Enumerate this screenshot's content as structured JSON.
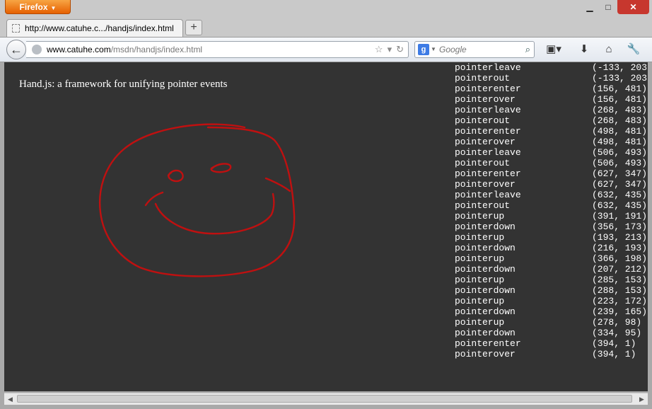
{
  "browser": {
    "menu_label": "Firefox",
    "tab_title": "http://www.catuhe.c.../handjs/index.html",
    "url_host": "www.catuhe.com",
    "url_path": "/msdn/handjs/index.html",
    "search_placeholder": "Google",
    "search_engine_letter": "g"
  },
  "page": {
    "heading": "Hand.js: a framework for unifying pointer events",
    "stroke_color": "#c01010",
    "background_color": "#333333"
  },
  "log": [
    {
      "event": "pointerleave",
      "coords": "(-133, 203"
    },
    {
      "event": "pointerout",
      "coords": "(-133, 203"
    },
    {
      "event": "pointerenter",
      "coords": "(156, 481)"
    },
    {
      "event": "pointerover",
      "coords": "(156, 481)"
    },
    {
      "event": "pointerleave",
      "coords": "(268, 483)"
    },
    {
      "event": "pointerout",
      "coords": "(268, 483)"
    },
    {
      "event": "pointerenter",
      "coords": "(498, 481)"
    },
    {
      "event": "pointerover",
      "coords": "(498, 481)"
    },
    {
      "event": "pointerleave",
      "coords": "(506, 493)"
    },
    {
      "event": "pointerout",
      "coords": "(506, 493)"
    },
    {
      "event": "pointerenter",
      "coords": "(627, 347)"
    },
    {
      "event": "pointerover",
      "coords": "(627, 347)"
    },
    {
      "event": "pointerleave",
      "coords": "(632, 435)"
    },
    {
      "event": "pointerout",
      "coords": "(632, 435)"
    },
    {
      "event": "pointerup",
      "coords": "(391, 191)"
    },
    {
      "event": "pointerdown",
      "coords": "(356, 173)"
    },
    {
      "event": "pointerup",
      "coords": "(193, 213)"
    },
    {
      "event": "pointerdown",
      "coords": "(216, 193)"
    },
    {
      "event": "pointerup",
      "coords": "(366, 198)"
    },
    {
      "event": "pointerdown",
      "coords": "(207, 212)"
    },
    {
      "event": "pointerup",
      "coords": "(285, 153)"
    },
    {
      "event": "pointerdown",
      "coords": "(288, 153)"
    },
    {
      "event": "pointerup",
      "coords": "(223, 172)"
    },
    {
      "event": "pointerdown",
      "coords": "(239, 165)"
    },
    {
      "event": "pointerup",
      "coords": "(278, 98)"
    },
    {
      "event": "pointerdown",
      "coords": "(334, 95)"
    },
    {
      "event": "pointerenter",
      "coords": "(394, 1)"
    },
    {
      "event": "pointerover",
      "coords": "(394, 1)"
    }
  ]
}
